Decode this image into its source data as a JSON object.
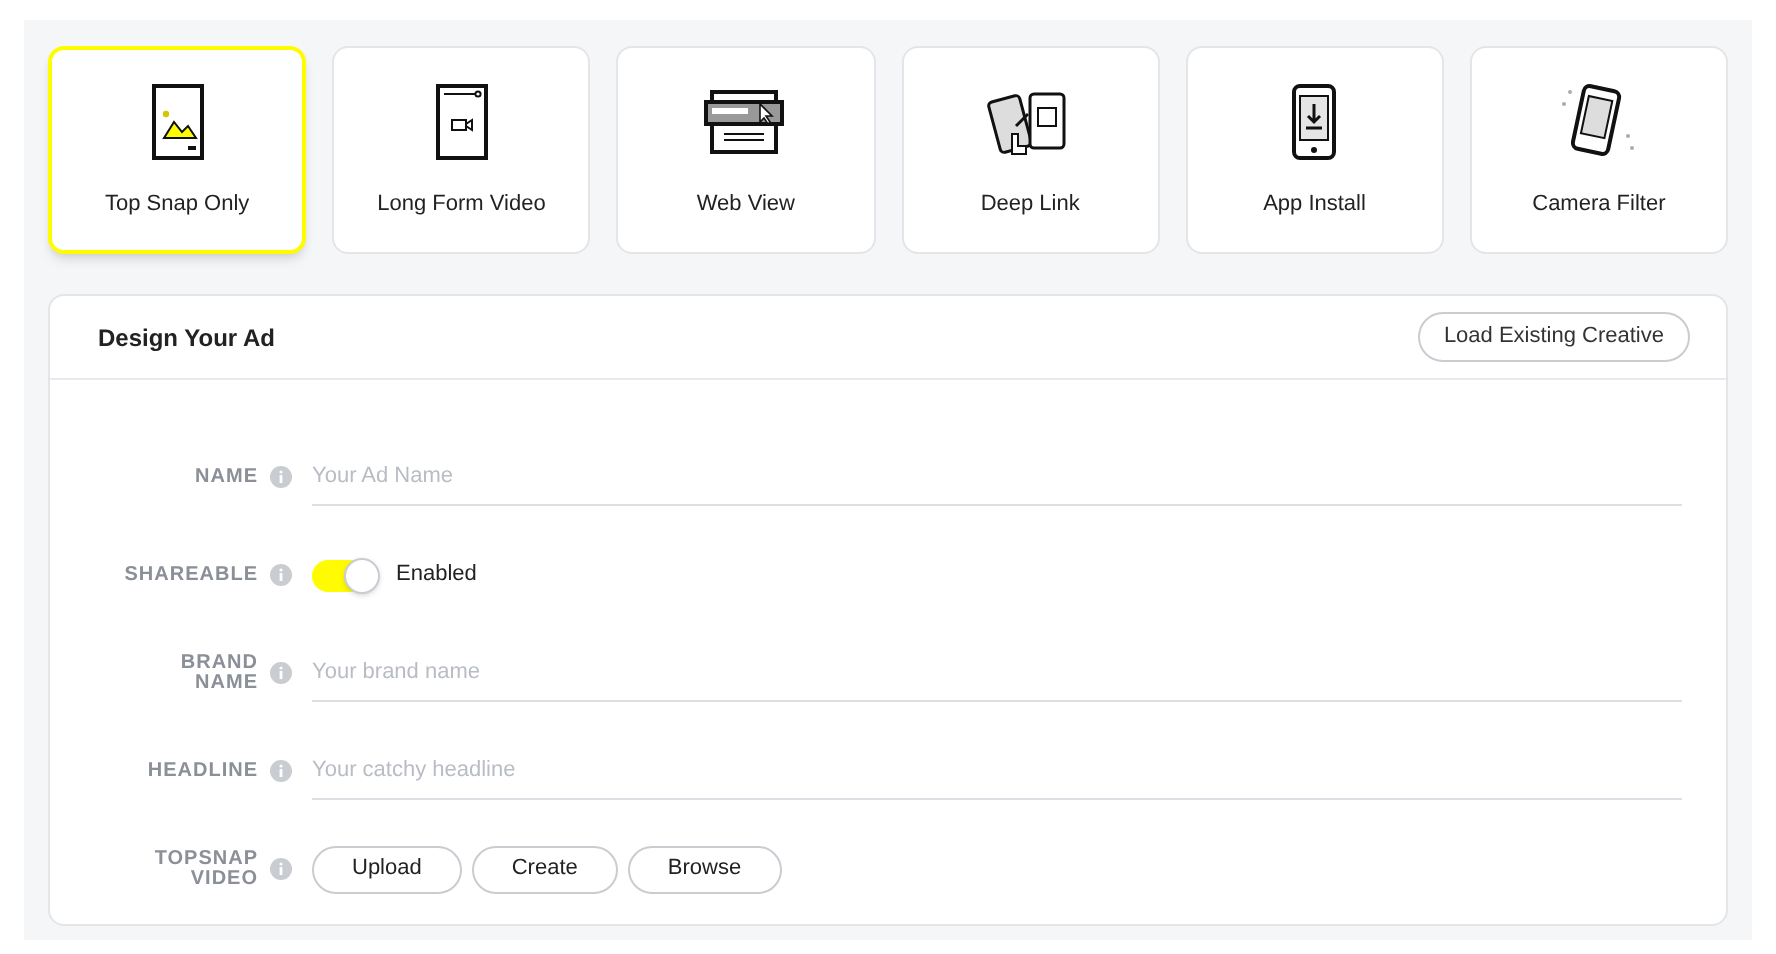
{
  "ad_types": [
    {
      "label": "Top Snap Only",
      "kind": "snap",
      "selected": true
    },
    {
      "label": "Long Form Video",
      "kind": "video",
      "selected": false
    },
    {
      "label": "Web View",
      "kind": "web",
      "selected": false
    },
    {
      "label": "Deep Link",
      "kind": "deeplink",
      "selected": false
    },
    {
      "label": "App Install",
      "kind": "install",
      "selected": false
    },
    {
      "label": "Camera Filter",
      "kind": "filter",
      "selected": false
    }
  ],
  "panel": {
    "title": "Design Your Ad",
    "action": "Load Existing Creative",
    "fields": [
      {
        "kind": "text",
        "label": "NAME",
        "placeholder": "Your Ad Name"
      },
      {
        "kind": "toggle",
        "label": "SHAREABLE",
        "on": true,
        "value": "Enabled"
      },
      {
        "kind": "text",
        "label": "BRAND NAME",
        "placeholder": "Your brand name"
      },
      {
        "kind": "text",
        "label": "HEADLINE",
        "placeholder": "Your catchy headline"
      },
      {
        "kind": "buttons",
        "label": "TOPSNAP VIDEO",
        "buttons": [
          "Upload",
          "Create",
          "Browse"
        ]
      }
    ]
  }
}
